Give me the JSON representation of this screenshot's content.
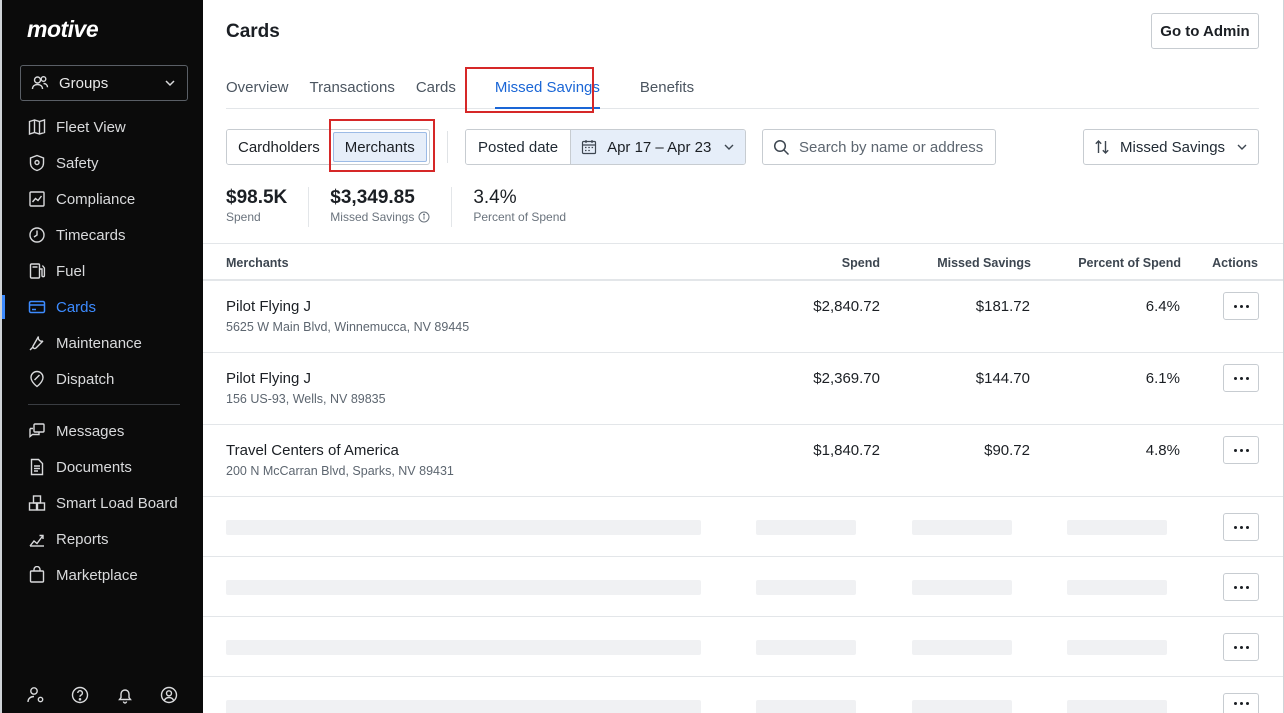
{
  "brand": {
    "logo": "motive"
  },
  "sidebar": {
    "groups_label": "Groups",
    "items": [
      {
        "label": "Fleet View",
        "icon": "map-icon"
      },
      {
        "label": "Safety",
        "icon": "shield-icon"
      },
      {
        "label": "Compliance",
        "icon": "compliance-icon"
      },
      {
        "label": "Timecards",
        "icon": "clock-icon"
      },
      {
        "label": "Fuel",
        "icon": "fuel-icon"
      },
      {
        "label": "Cards",
        "icon": "card-icon",
        "active": true
      },
      {
        "label": "Maintenance",
        "icon": "wrench-icon"
      },
      {
        "label": "Dispatch",
        "icon": "dispatch-icon"
      }
    ],
    "items2": [
      {
        "label": "Messages",
        "icon": "messages-icon"
      },
      {
        "label": "Documents",
        "icon": "document-icon"
      },
      {
        "label": "Smart Load Board",
        "icon": "load-board-icon"
      },
      {
        "label": "Reports",
        "icon": "reports-icon"
      },
      {
        "label": "Marketplace",
        "icon": "marketplace-icon"
      }
    ],
    "footer_icons": [
      "user-settings-icon",
      "help-icon",
      "bell-icon",
      "profile-icon"
    ]
  },
  "header": {
    "title": "Cards",
    "admin_button": "Go to Admin"
  },
  "tabs": [
    {
      "label": "Overview"
    },
    {
      "label": "Transactions"
    },
    {
      "label": "Cards"
    },
    {
      "label": "Missed Savings",
      "active": true
    },
    {
      "label": "Benefits"
    }
  ],
  "filters": {
    "view_toggle": [
      "Cardholders",
      "Merchants"
    ],
    "view_selected": "Merchants",
    "date_label": "Posted date",
    "date_range": "Apr 17 – Apr 23",
    "search_placeholder": "Search by name or address",
    "sort_label": "Missed Savings"
  },
  "stats": [
    {
      "value": "$98.5K",
      "label": "Spend"
    },
    {
      "value": "$3,349.85",
      "label": "Missed Savings"
    },
    {
      "value": "3.4%",
      "label": "Percent of Spend"
    }
  ],
  "table": {
    "columns": [
      "Merchants",
      "Spend",
      "Missed Savings",
      "Percent of Spend",
      "Actions"
    ],
    "rows": [
      {
        "name": "Pilot Flying J",
        "address": "5625 W Main Blvd, Winnemucca, NV 89445",
        "spend": "$2,840.72",
        "missed": "$181.72",
        "percent": "6.4%"
      },
      {
        "name": "Pilot Flying J",
        "address": "156 US-93, Wells, NV 89835",
        "spend": "$2,369.70",
        "missed": "$144.70",
        "percent": "6.1%"
      },
      {
        "name": "Travel Centers of America",
        "address": "200 N McCarran Blvd, Sparks, NV 89431",
        "spend": "$1,840.72",
        "missed": "$90.72",
        "percent": "4.8%"
      }
    ],
    "loading_rows": 4
  },
  "colors": {
    "accent": "#1a66d6",
    "highlight": "#d62828",
    "sidebar_bg": "#0b0b0b"
  }
}
